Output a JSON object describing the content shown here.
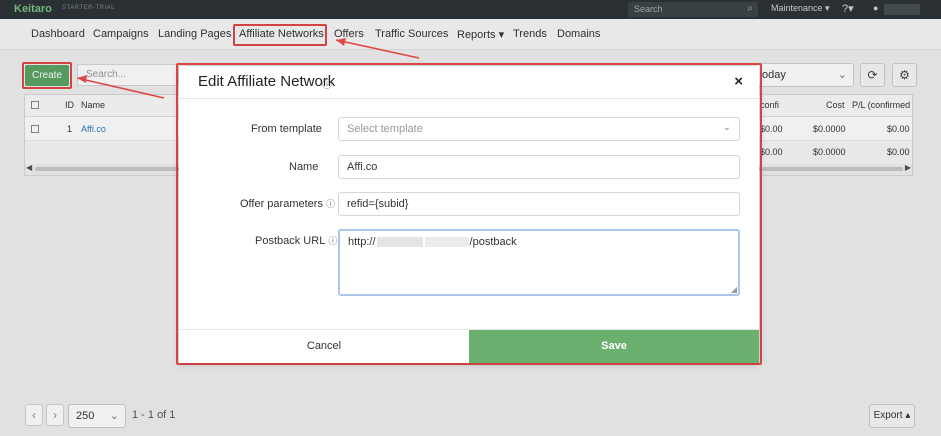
{
  "topbar": {
    "logo": "Keitaro",
    "logo_sub": "STARTER-TRIAL",
    "search_placeholder": "Search",
    "maintenance": "Maintenance ▾",
    "help": "❓▾",
    "user": "👤"
  },
  "nav": {
    "items": [
      "Dashboard",
      "Campaigns",
      "Landing Pages",
      "Affiliate Networks",
      "Offers",
      "Traffic Sources",
      "Reports ▾",
      "Trends",
      "Domains"
    ]
  },
  "toolbar": {
    "create": "Create",
    "search_placeholder": "Search...",
    "date_value": "oday",
    "refresh_icon": "⟳",
    "settings_icon": "⚙"
  },
  "table": {
    "headers": [
      "ID",
      "Name",
      "confi",
      "Cost",
      "P/L (confirmed"
    ],
    "rows": [
      {
        "id": "1",
        "name": "Affi.co",
        "confi": "$0.00",
        "cost": "$0.0000",
        "pl": "$0.00"
      }
    ],
    "totals": {
      "confi": "$0.00",
      "cost": "$0.0000",
      "pl": "$0.00"
    }
  },
  "modal": {
    "title": "Edit Affiliate Network",
    "title_help": "?",
    "close": "×",
    "fields": {
      "template_label": "From template",
      "template_placeholder": "Select template",
      "name_label": "Name",
      "name_value": "Affi.co",
      "offer_params_label": "Offer parameters",
      "offer_params_value": "refid={subid}",
      "postback_label": "Postback URL",
      "postback_prefix": "http://",
      "postback_suffix": "/postback"
    },
    "cancel": "Cancel",
    "save": "Save"
  },
  "pagination": {
    "prev": "‹",
    "next": "›",
    "per_page": "250",
    "info": "1 - 1 of 1",
    "export": "Export ▴"
  },
  "colors": {
    "topbar": "#2d3438",
    "accent_green": "#5ca465",
    "save_green": "#6cb06f",
    "highlight_red": "#e04848",
    "link_blue": "#2a78c5"
  }
}
